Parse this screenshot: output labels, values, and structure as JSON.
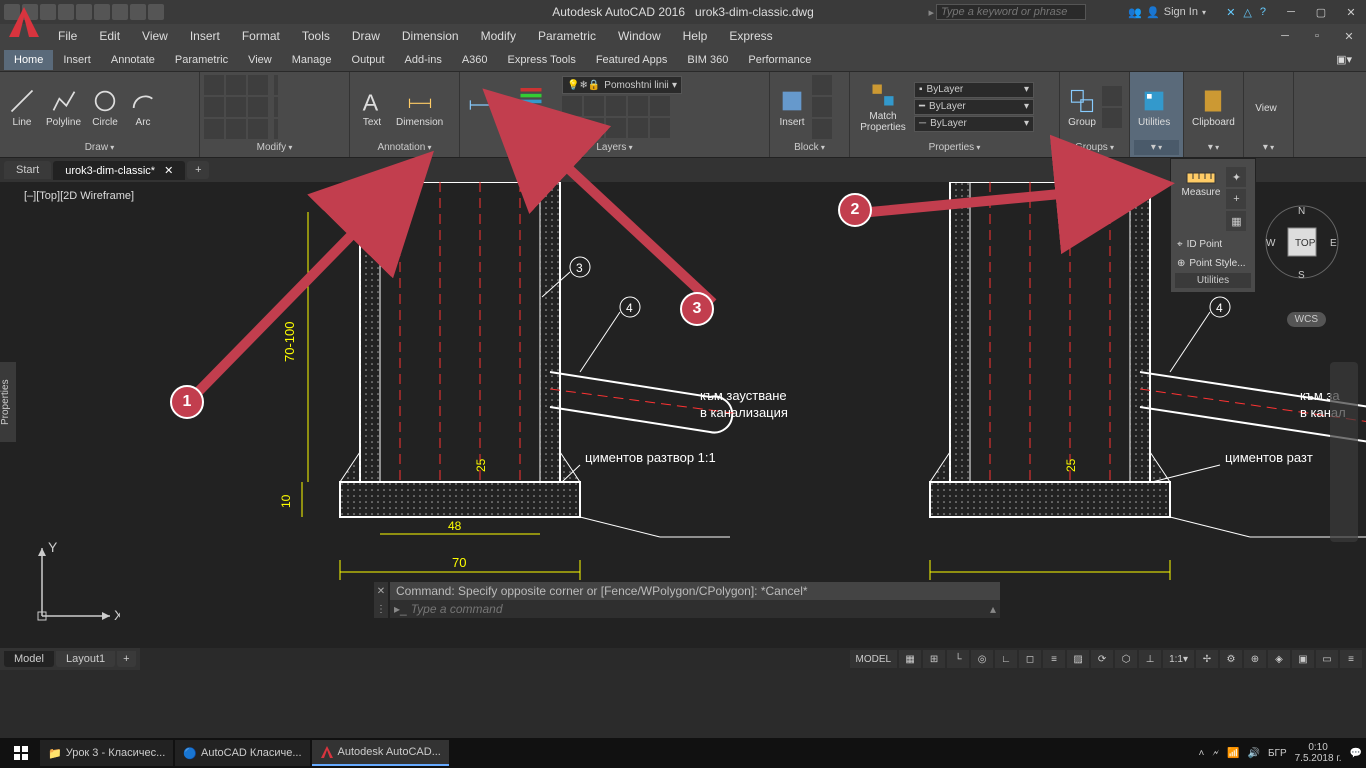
{
  "title": {
    "app": "Autodesk AutoCAD 2016",
    "file": "urok3-dim-classic.dwg",
    "search_placeholder": "Type a keyword or phrase",
    "signin": "Sign In"
  },
  "menu": [
    "File",
    "Edit",
    "View",
    "Insert",
    "Format",
    "Tools",
    "Draw",
    "Dimension",
    "Modify",
    "Parametric",
    "Window",
    "Help",
    "Express"
  ],
  "ribbon_tabs": [
    "Home",
    "Insert",
    "Annotate",
    "Parametric",
    "View",
    "Manage",
    "Output",
    "Add-ins",
    "A360",
    "Express Tools",
    "Featured Apps",
    "BIM 360",
    "Performance"
  ],
  "ribbon_active": "Home",
  "panels": {
    "draw": {
      "label": "Draw",
      "items": [
        "Line",
        "Polyline",
        "Circle",
        "Arc"
      ]
    },
    "modify": {
      "label": "Modify"
    },
    "annotation": {
      "label": "Annotation",
      "text": "Text",
      "dimension": "Dimension"
    },
    "layers": {
      "label": "Layers",
      "btn": "Layer Properties",
      "current": "Pomoshtni linii"
    },
    "block": {
      "label": "Block",
      "insert": "Insert"
    },
    "properties": {
      "label": "Properties",
      "match": "Match Properties",
      "bylayer": "ByLayer"
    },
    "groups": {
      "label": "Groups",
      "group": "Group"
    },
    "utilities": {
      "label": "Utilities"
    },
    "clipboard": {
      "label": "Clipboard"
    },
    "view": {
      "label": "View"
    }
  },
  "utilities_flyout": {
    "measure": "Measure",
    "idpoint": "ID Point",
    "pointstyle": "Point Style...",
    "label": "Utilities"
  },
  "doc_tabs": {
    "start": "Start",
    "active": "urok3-dim-classic*"
  },
  "viewport": {
    "label": "[–][Top][2D Wireframe]",
    "wcs": "WCS",
    "cube_top": "TOP",
    "cube_n": "N",
    "cube_s": "S",
    "cube_e": "E",
    "cube_w": "W"
  },
  "side_panel": "Properties",
  "drawing": {
    "dim_70_100": "70-100",
    "dim_10": "10",
    "dim_25": "25",
    "dim_48": "48",
    "dim_70": "70",
    "leader_3": "3",
    "leader_4": "4",
    "text_canal": "към заустване",
    "text_canal2": "в канализация",
    "text_cement": "циментов разтвор 1:1",
    "text_canal_r1": "към за",
    "text_canal_r2": "в канал",
    "text_cement_r": "циментов разт"
  },
  "cmd": {
    "history": "Command: Specify opposite corner or [Fence/WPolygon/CPolygon]: *Cancel*",
    "placeholder": "Type a command"
  },
  "layout_tabs": [
    "Model",
    "Layout1"
  ],
  "statusbar": {
    "model": "MODEL",
    "scale": "1:1"
  },
  "taskbar": {
    "folder": "Урок 3 - Класичес...",
    "chrome": "AutoCAD Класиче...",
    "acad": "Autodesk AutoCAD...",
    "lang": "БГР",
    "time": "0:10",
    "date": "7.5.2018 г."
  },
  "markers": {
    "one": "1",
    "two": "2",
    "three": "3"
  },
  "ucs_labels": {
    "x": "X",
    "y": "Y"
  }
}
